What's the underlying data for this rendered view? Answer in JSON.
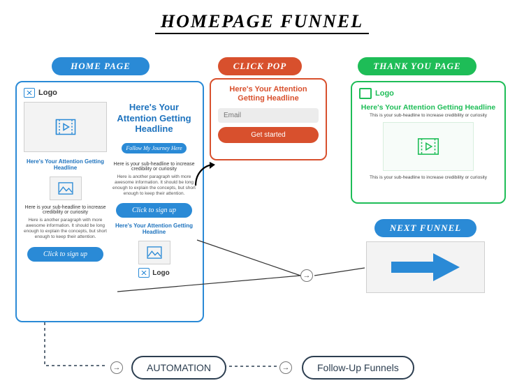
{
  "title": "HOMEPAGE FUNNEL",
  "pills": {
    "home": "HOME PAGE",
    "clickpop": "CLICK POP",
    "thankyou": "THANK YOU PAGE",
    "nextfunnel": "NEXT FUNNEL"
  },
  "home_card": {
    "logo": "Logo",
    "left": {
      "headline": "Here's Your Attention Getting Headline",
      "sub": "Here is your sub-headline to increase credibility or curiosity",
      "para": "Here is another paragraph with more awesome information. It should be long enough to explain the concepts, but short enough to keep their attention.",
      "cta": "Click to sign up"
    },
    "right": {
      "headline": "Here's Your Attention Getting Headline",
      "follow": "Follow My Journey Here",
      "sub": "Here is your sub-headline to increase credibility or curiosity",
      "para": "Here is another paragraph with more awesome information. It should be long enough to explain the concepts, but short enough to keep their attention.",
      "cta": "Click to sign up",
      "headline2": "Here's Your Attention Getting Headline"
    },
    "footer_logo": "Logo"
  },
  "clickpop_card": {
    "headline": "Here's Your Attention Getting Headline",
    "placeholder": "Email",
    "button": "Get started"
  },
  "thankyou_card": {
    "logo": "Logo",
    "headline": "Here's Your Attention Getting Headline",
    "sub": "This is your sub-headline to increase credibility or curiosity",
    "sub2": "This is your sub-headline to increase credibility or curiosity"
  },
  "flow": {
    "automation": "AUTOMATION",
    "followup": "Follow-Up Funnels"
  }
}
